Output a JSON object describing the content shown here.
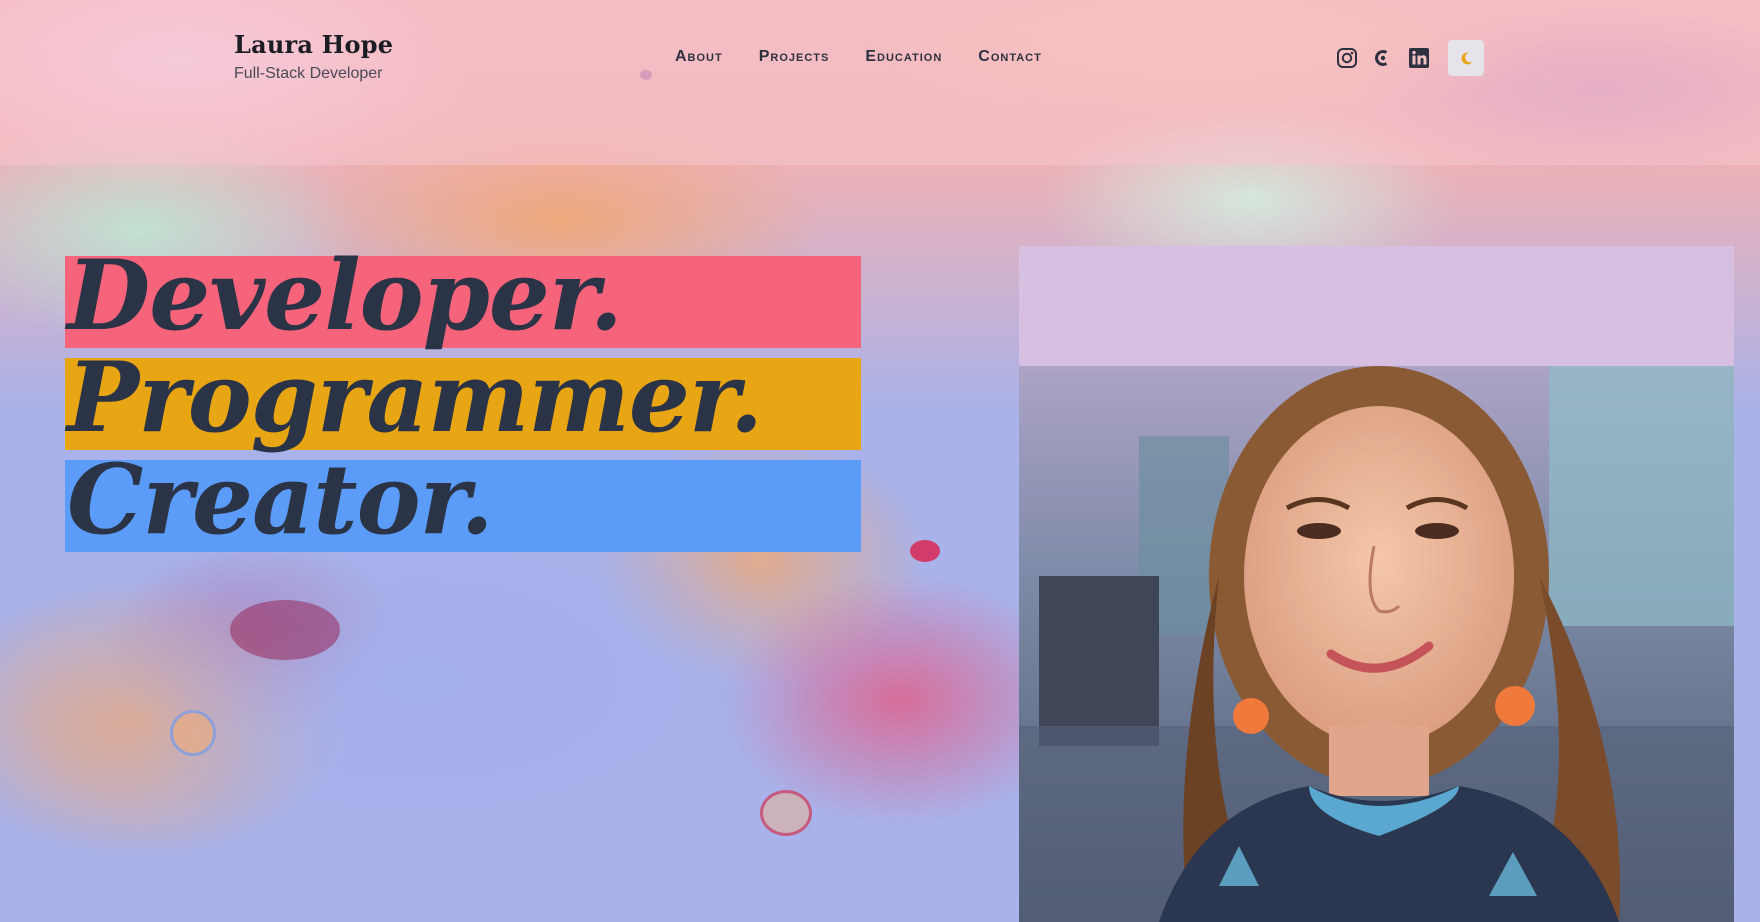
{
  "brand": {
    "name": "Laura Hope",
    "subtitle": "Full-Stack Developer"
  },
  "nav": {
    "items": [
      "About",
      "Projects",
      "Education",
      "Contact"
    ]
  },
  "social": {
    "icons": [
      "instagram-icon",
      "codepen-icon",
      "linkedin-icon"
    ],
    "theme_toggle_icon": "moon-icon"
  },
  "hero": {
    "words": [
      {
        "text": "Developer.",
        "color": "#f5647a"
      },
      {
        "text": "Programmer.",
        "color": "#e8a514"
      },
      {
        "text": "Creator.",
        "color": "#5a9cf8"
      }
    ]
  },
  "portrait": {
    "alt_icon": "portrait-photo"
  },
  "colors": {
    "text_dark": "#2b3447",
    "toggle_bg": "#e6e3ea",
    "moon": "#e8a514"
  }
}
